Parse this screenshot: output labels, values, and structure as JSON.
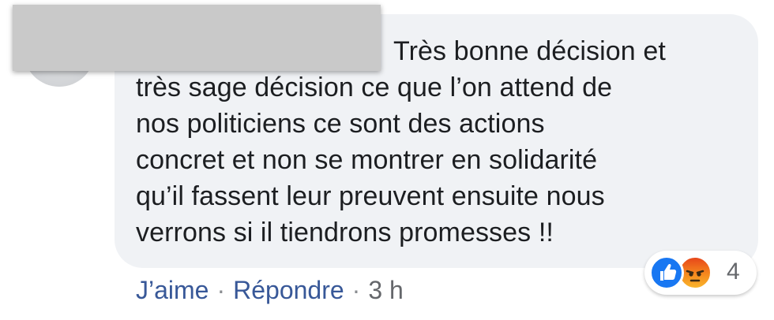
{
  "comment": {
    "lines": [
      "Très bonne décision et",
      "très sage décision ce que l’on attend de",
      "nos politiciens ce sont des actions",
      "concret et non se montrer en solidarité",
      "qu’il fassent leur preuvent ensuite nous",
      "verrons si il tiendrons promesses !!"
    ]
  },
  "reactions": {
    "icons": [
      "like-icon",
      "angry-icon"
    ],
    "count": "4",
    "colors": {
      "like": "#1877f2",
      "angry": "#f5891e"
    }
  },
  "actions": {
    "like_label": "J’aime",
    "separator": "·",
    "reply_label": "Répondre",
    "timestamp": "3 h"
  },
  "colors": {
    "bubble_bg": "#f0f2f5",
    "link": "#385898",
    "text": "#1c1e21"
  }
}
